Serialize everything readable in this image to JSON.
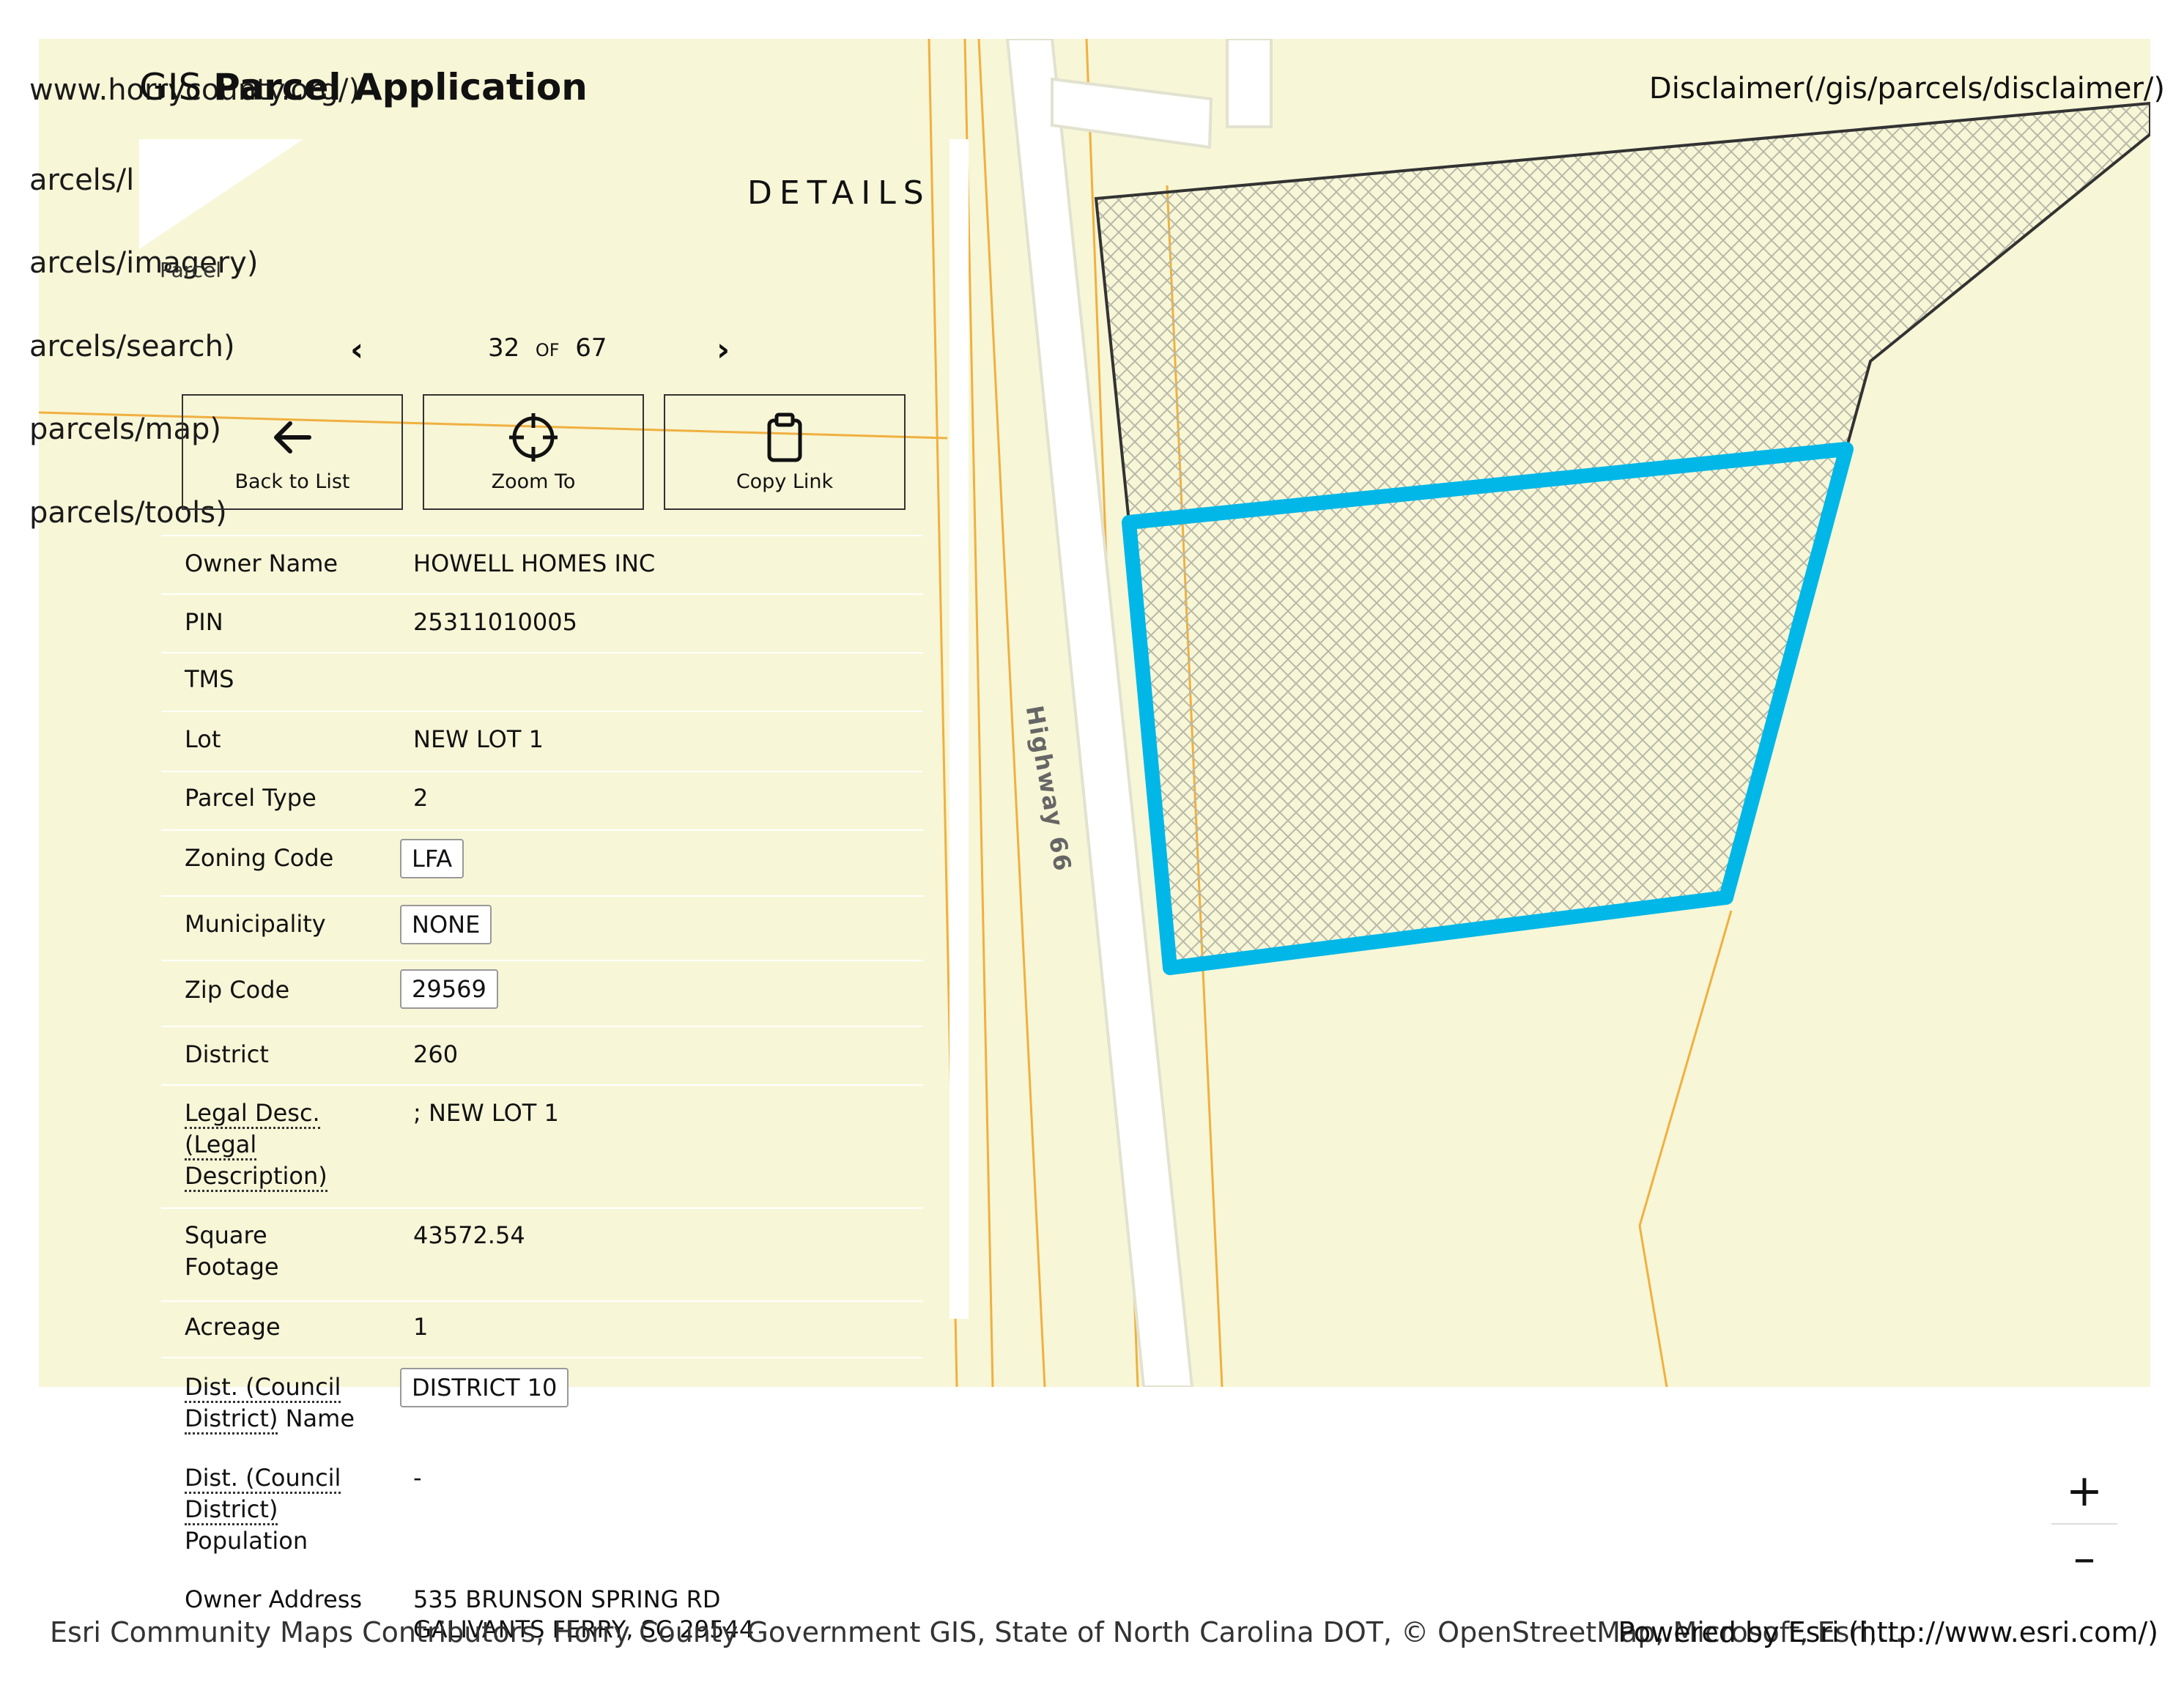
{
  "nav_links": [
    "www.horrycounty.org/)",
    "arcels/l",
    "arcels/imagery)",
    "arcels/search)",
    "parcels/map)",
    "parcels/tools)"
  ],
  "header": {
    "gis_prefix": "GIS",
    "title": "Parcel Application",
    "disclaimer": "Disclaimer(/gis/parcels/disclaimer/)"
  },
  "panel": {
    "title": "DETAILS",
    "parcel_label": "Parcel",
    "pager": {
      "current": "32",
      "of_label": "OF",
      "total": "67",
      "prev_icon": "chevron-left-icon",
      "next_icon": "chevron-right-icon"
    },
    "actions": [
      {
        "label": "Back to List",
        "icon": "arrow-left-icon"
      },
      {
        "label": "Zoom To",
        "icon": "crosshair-icon"
      },
      {
        "label": "Copy Link",
        "icon": "clipboard-icon"
      }
    ],
    "fields": {
      "owner_name": {
        "label": "Owner Name",
        "value": "HOWELL HOMES INC"
      },
      "pin": {
        "label": "PIN",
        "value": "25311010005"
      },
      "tms": {
        "label": "TMS",
        "value": ""
      },
      "lot": {
        "label": "Lot",
        "value": "NEW LOT 1"
      },
      "parcel_type": {
        "label": "Parcel Type",
        "value": "2"
      },
      "zoning_code": {
        "label": "Zoning Code",
        "value": "LFA"
      },
      "municipality": {
        "label": "Municipality",
        "value": "NONE"
      },
      "zip_code": {
        "label": "Zip Code",
        "value": "29569"
      },
      "district": {
        "label": "District",
        "value": "260"
      },
      "legal_desc": {
        "label_line1": "Legal Desc.",
        "label_line2": "(Legal",
        "label_line3": "Description)",
        "value": "; NEW LOT 1"
      },
      "square_footage": {
        "label_line1": "Square",
        "label_line2": "Footage",
        "value": "43572.54"
      },
      "acreage": {
        "label": "Acreage",
        "value": "1"
      },
      "council_district_name": {
        "label_line1": "Dist. (Council",
        "label_line2": "District)",
        "label_suffix": " Name",
        "value": "DISTRICT 10"
      },
      "council_district_population": {
        "label_line1": "Dist. (Council",
        "label_line2": "District)",
        "label_line3": "Population",
        "value": "-"
      },
      "owner_address": {
        "label": "Owner Address",
        "value_line1": "535 BRUNSON SPRING RD",
        "value_line2": "GALIVANTS FERRY, SC 29544"
      }
    }
  },
  "map": {
    "road_label": "Highway 66",
    "zoom_in": "+",
    "zoom_out": "–",
    "colors": {
      "background": "#f7f6d7",
      "selection": "#00b7e8",
      "parcel_line": "#f0b040",
      "road": "#ffffff"
    }
  },
  "footer": {
    "attribution": "Esri Community Maps Contributors, Horry County Government GIS, State of North Carolina DOT, © OpenStreetMap, Microsoft, Esri,...",
    "powered_by": "Powered by Esri (http://www.esri.com/)"
  }
}
